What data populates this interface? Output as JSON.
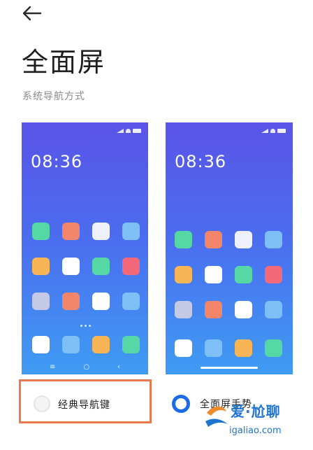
{
  "header": {
    "back_icon": "arrow-left-icon",
    "title": "全面屏"
  },
  "section": {
    "label": "系统导航方式"
  },
  "previews": [
    {
      "clock": "08:36",
      "apps": [
        "#56d8a6",
        "#f3856b",
        "#eef0fb",
        "#7ec0f5",
        "#f7b556",
        "#ffffff",
        "#56d8a6",
        "#f3697a",
        "#c4c9e6",
        "#f3856b",
        "#ffffff",
        "#7ec0f5",
        "#ffffff",
        "#7ec0f5",
        "#f7b556",
        "#56d8a6"
      ],
      "nav_icons": [
        "≡",
        "○",
        "‹"
      ]
    },
    {
      "clock": "08:36",
      "apps": [
        "#56d8a6",
        "#f3856b",
        "#eef0fb",
        "#7ec0f5",
        "#f7b556",
        "#ffffff",
        "#56d8a6",
        "#f3697a",
        "#c4c9e6",
        "#f3856b",
        "#ffffff",
        "#7ec0f5",
        "#ffffff",
        "#7ec0f5",
        "#f7b556",
        "#56d8a6"
      ]
    }
  ],
  "options": [
    {
      "label": "经典导航键",
      "selected": false
    },
    {
      "label": "全面屏手势",
      "selected": true
    }
  ],
  "watermark": {
    "title": "爱·尬聊",
    "url": "igaliao.com"
  },
  "colors": {
    "highlight_border": "#ea7a4e",
    "radio_selected": "#1c6be6",
    "watermark": "#1f74d1"
  }
}
